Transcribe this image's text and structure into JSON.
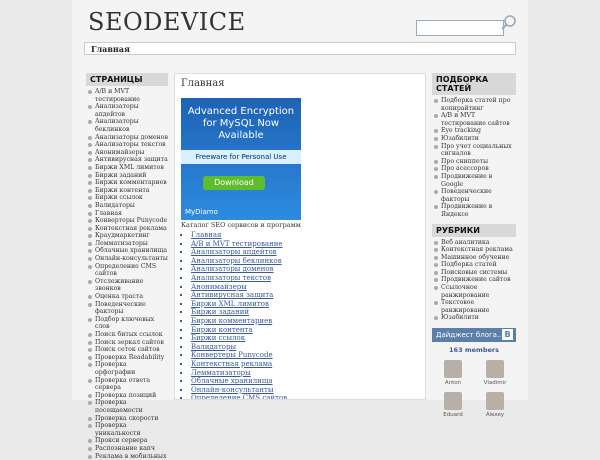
{
  "header": {
    "logo": "SEODEVICE",
    "search_placeholder": ""
  },
  "breadcrumb": {
    "label": "Главная"
  },
  "left": {
    "title": "СТРАНИЦЫ",
    "items": [
      "A/B и MVT тестирование",
      "Анализаторы апдейтов",
      "Анализаторы беклинков",
      "Анализаторы доменов",
      "Анализаторы текстов",
      "Анонимайзеры",
      "Антивирусная защита",
      "Биржи XML лимитов",
      "Биржи заданий",
      "Биржи комментариев",
      "Биржи контента",
      "Биржи ссылок",
      "Валидаторы",
      "Главная",
      "Конвертеры Punycode",
      "Контекстная реклама",
      "Краудмаркетинг",
      "Лемматизаторы",
      "Облачные хранилища",
      "Онлайн-консультанты",
      "Определение CMS сайтов",
      "Отслеживание звонков",
      "Оценка траста",
      "Поведенческие факторы",
      "Подбор ключевых слов",
      "Поиск битых ссылок",
      "Поиск зеркал сайтов",
      "Поиск сеток сайтов",
      "Проверка Readability",
      "Проверка орфографии",
      "Проверка ответа сервера",
      "Проверка позиций",
      "Проверка посещаемости",
      "Проверка скорости",
      "Проверка уникальности",
      "Прокси сервера",
      "Распознание капч",
      "Реклама в мобильных"
    ]
  },
  "main": {
    "title": "Главная",
    "ad": {
      "headline": "Advanced Encryption for MySQL Now Available",
      "sub": "Freeware for Personal Use",
      "button": "Download",
      "brand": "MyDiamo"
    },
    "catalog": "Каталог SEO сервисов и программ",
    "links": [
      "Главная",
      "A/B и MVT тестирование",
      "Анализаторы апдейтов",
      "Анализаторы беклинков",
      "Анализаторы доменов",
      "Анализаторы текстов",
      "Анонимайзеры",
      "Антивирусная защита",
      "Биржи XML лимитов",
      "Биржи заданий",
      "Биржи комментариев",
      "Биржи контента",
      "Биржи ссылок",
      "Валидаторы",
      "Конвертеры Punycode",
      "Контекстная реклама",
      "Лемматизаторы",
      "Облачные хранилища",
      "Онлайн-консультанты",
      "Определение CMS сайтов"
    ]
  },
  "right": {
    "articles_title": "ПОДБОРКА СТАТЕЙ",
    "articles": [
      "Подборка статей про копирайтинг",
      "A/B и MVT тестирование сайтов",
      "Eye tracking",
      "Юзабилити",
      "Про учет социальных сигналов",
      "Про сниппеты",
      "Про асессоров",
      "Продвижение в Google",
      "Поведенческие факторы",
      "Продвижение в Яндексе"
    ],
    "rubrics_title": "РУБРИКИ",
    "rubrics": [
      "Веб аналитика",
      "Контекстная реклама",
      "Машинное обучение",
      "Подборка статей",
      "Поисковые системы",
      "Продвижение сайтов",
      "Ссылочное ранжирование",
      "Текстовое ранжирование",
      "Юзабилити"
    ],
    "vk_title": "Дайджест блога...",
    "vk_logo": "B",
    "members": "163 members",
    "avatars": [
      "Anton",
      "Vladimir",
      "Eduard",
      "Alexey"
    ]
  }
}
